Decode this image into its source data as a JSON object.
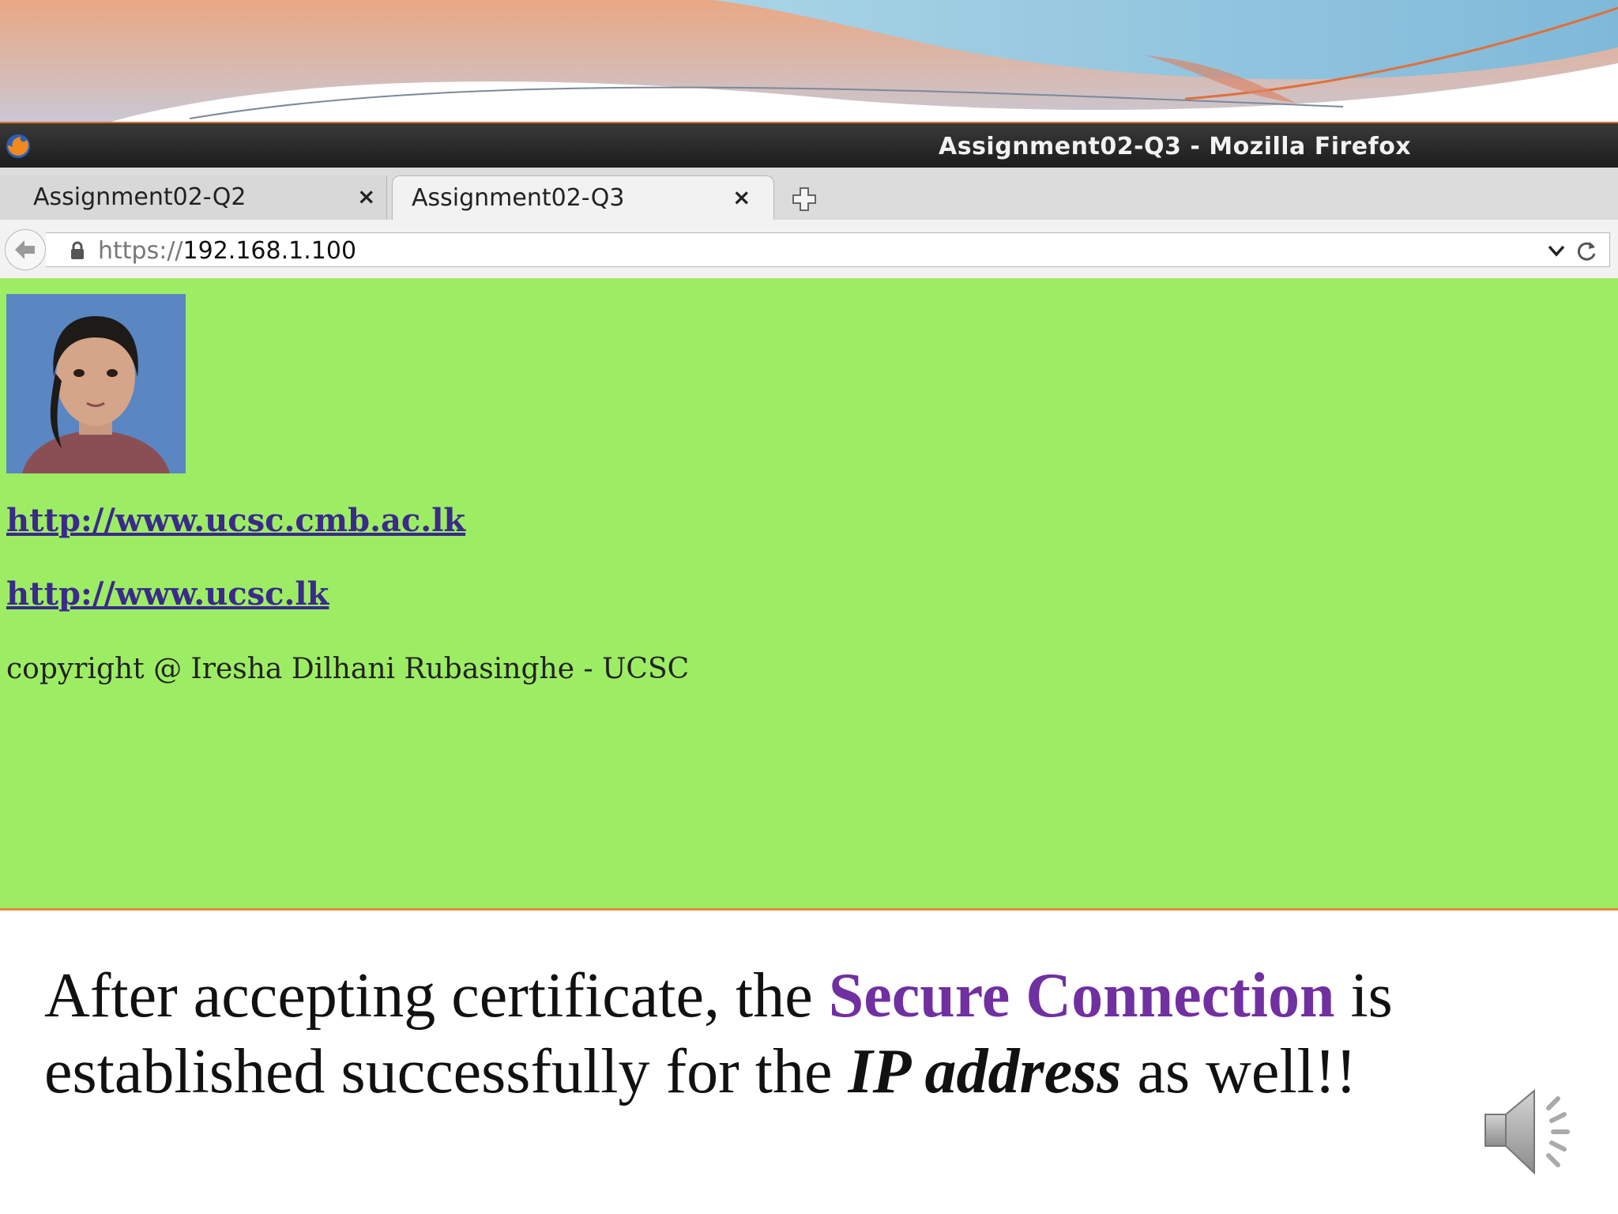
{
  "browser": {
    "window_title": "Assignment02-Q3 - Mozilla Firefox",
    "tabs": [
      {
        "label": "Assignment02-Q2",
        "active": false
      },
      {
        "label": "Assignment02-Q3",
        "active": true
      }
    ],
    "close_glyph": "×",
    "address": {
      "scheme": "https://",
      "host": "192.168.1.100"
    }
  },
  "page": {
    "background_color": "#9ded64",
    "links": [
      "http://www.ucsc.cmb.ac.lk",
      "http://www.ucsc.lk"
    ],
    "copyright": "copyright @ Iresha Dilhani Rubasinghe - UCSC"
  },
  "slide": {
    "caption": {
      "part1": "After accepting certificate, the ",
      "highlight": "Secure Connection",
      "part2": " is established successfully for the ",
      "emphasis": "IP address",
      "part3": " as well!!"
    },
    "highlight_color": "#7030a0"
  },
  "icons": [
    "firefox-logo-icon",
    "new-tab-icon",
    "back-arrow-icon",
    "lock-icon",
    "dropdown-chevron-icon",
    "reload-icon",
    "speaker-icon"
  ]
}
